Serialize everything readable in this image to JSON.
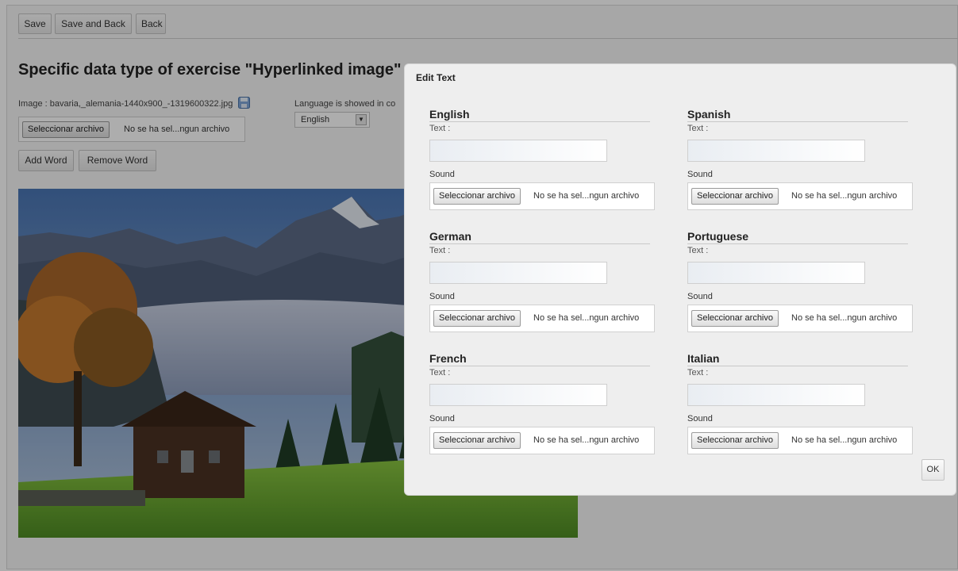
{
  "toolbar": {
    "save_label": "Save",
    "save_back_label": "Save and Back",
    "back_label": "Back"
  },
  "main": {
    "title": "Specific data type of exercise \"Hyperlinked image\"",
    "image_label": "Image : bavaria,_alemania-1440x900_-1319600322.jpg",
    "language_info": "Language is showed in co",
    "language_select": "English",
    "file_button": "Seleccionar archivo",
    "file_status": "No se ha sel...ngun archivo",
    "add_word_label": "Add Word",
    "remove_word_label": "Remove Word"
  },
  "dialog": {
    "title": "Edit Text",
    "text_label": "Text :",
    "sound_label": "Sound",
    "file_button": "Seleccionar archivo",
    "file_status": "No se ha sel...ngun archivo",
    "ok_label": "OK",
    "languages": [
      {
        "name": "English"
      },
      {
        "name": "Spanish"
      },
      {
        "name": "German"
      },
      {
        "name": "Portuguese"
      },
      {
        "name": "French"
      },
      {
        "name": "Italian"
      }
    ]
  },
  "colors": {
    "overlay": "#000000",
    "dialog_bg": "#eeeeee",
    "page_bg": "#f6f6f6"
  }
}
